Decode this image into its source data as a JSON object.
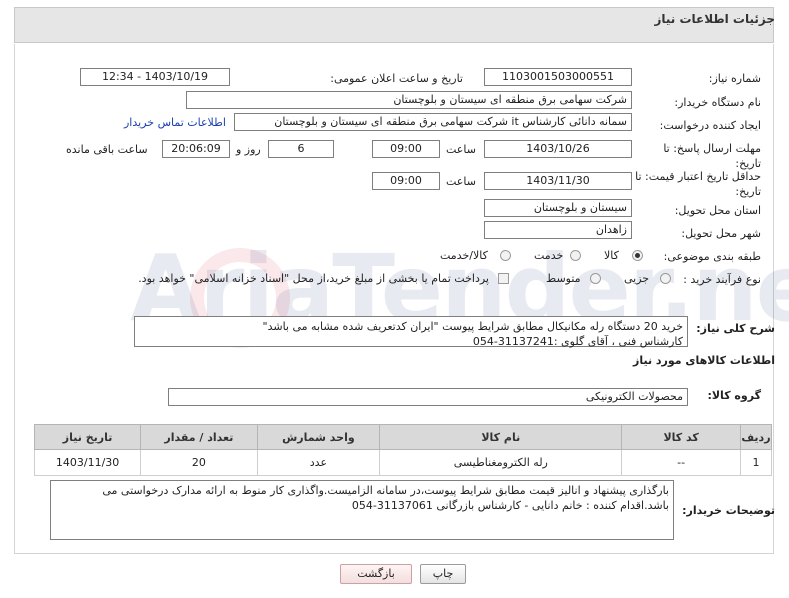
{
  "header": {
    "title": "جزئیات اطلاعات نیاز"
  },
  "fields": {
    "need_number_label": "شماره نیاز:",
    "need_number": "1103001503000551",
    "announce_label": "تاریخ و ساعت اعلان عمومی:",
    "announce_value": "1403/10/19 - 12:34",
    "buyer_org_label": "نام دستگاه خریدار:",
    "buyer_org": "شرکت سهامی برق منطقه ای سیستان و بلوچستان",
    "creator_label": "ایجاد کننده درخواست:",
    "creator": "سمانه دانائی کارشناس it شرکت سهامی برق منطقه ای سیستان و بلوچستان",
    "contact_link": "اطلاعات تماس خریدار",
    "deadline_label": "مهلت ارسال پاسخ: تا تاریخ:",
    "deadline_date": "1403/10/26",
    "time_label": "ساعت",
    "deadline_time": "09:00",
    "days_value": "6",
    "days_label": "روز و",
    "remaining_time": "20:06:09",
    "remaining_label": "ساعت باقی مانده",
    "validity_label": "حداقل تاریخ اعتبار قیمت: تا تاریخ:",
    "validity_date": "1403/11/30",
    "validity_time": "09:00",
    "province_label": "استان محل تحویل:",
    "province": "سیستان و بلوچستان",
    "city_label": "شهر محل تحویل:",
    "city": "زاهدان",
    "category_label": "طبقه بندی موضوعی:",
    "category_options": [
      "کالا",
      "خدمت",
      "کالا/خدمت"
    ],
    "category_selected": "کالا",
    "process_label": "نوع فرآیند خرید :",
    "process_options": [
      "جزیی",
      "متوسط"
    ],
    "process_selected": "",
    "payment_note": "پرداخت تمام یا بخشی از مبلغ خرید،از محل \"اسناد خزانه اسلامی\" خواهد بود."
  },
  "description": {
    "label": "شرح کلی نیاز:",
    "text": "خرید 20 دستگاه رله مکانیکال مطابق شرایط پیوست \"ایران کدتعریف شده مشابه می باشد\"\nکارشناس فنی ، آقای گلوی :31137241-054"
  },
  "goods": {
    "section_title": "اطلاعات کالاهای مورد نیاز",
    "group_label": "گروه کالا:",
    "group_value": "محصولات الکترونیکی",
    "columns": [
      "ردیف",
      "کد کالا",
      "نام کالا",
      "واحد شمارش",
      "تعداد / مقدار",
      "تاریخ نیاز"
    ],
    "rows": [
      {
        "row": "1",
        "code": "--",
        "name": "رله الکترومغناطیسی",
        "unit": "عدد",
        "qty": "20",
        "date": "1403/11/30"
      }
    ]
  },
  "buyer_notes": {
    "label": "توضیحات خریدار:",
    "text": "بارگذاری پیشنهاد و انالیز قیمت مطابق شرایط پیوست،در سامانه الزامیست.واگذاری کار منوط به ارائه مدارک درخواستی می باشد.اقدام کننده : خانم دانایی - کارشناس بازرگانی 31137061-054"
  },
  "buttons": {
    "print": "چاپ",
    "back": "بازگشت"
  },
  "watermark": "AriaTender.neT"
}
